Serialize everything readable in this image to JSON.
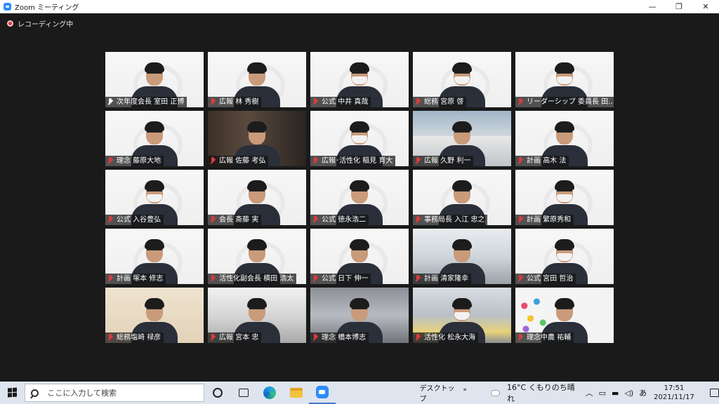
{
  "window": {
    "title": "Zoom ミーティング",
    "controls": [
      "minimize",
      "maximize",
      "close"
    ]
  },
  "recording": {
    "label": "レコーディング中"
  },
  "participants": [
    {
      "label": "次年度会長 室田 正博",
      "active": true,
      "mic": "on",
      "mask": false,
      "bg": "banner"
    },
    {
      "label": "広報 林 秀樹",
      "active": false,
      "mic": "muted",
      "mask": false,
      "bg": "banner"
    },
    {
      "label": "公式 中井 真哉",
      "active": false,
      "mic": "muted",
      "mask": true,
      "bg": "banner"
    },
    {
      "label": "総務 宮原 啓",
      "active": false,
      "mic": "muted",
      "mask": true,
      "bg": "banner"
    },
    {
      "label": "リーダーシップ 委員長 田…",
      "active": false,
      "mic": "muted",
      "mask": true,
      "bg": "banner"
    },
    {
      "label": "理念 藤原大地",
      "active": false,
      "mic": "muted",
      "mask": false,
      "bg": "banner"
    },
    {
      "label": "広報 佐藤 考弘",
      "active": false,
      "mic": "muted",
      "mask": false,
      "bg": "room"
    },
    {
      "label": "広報･活性化 稲見 育大",
      "active": false,
      "mic": "muted",
      "mask": true,
      "bg": "banner"
    },
    {
      "label": "広報 久野 利一",
      "active": false,
      "mic": "muted",
      "mask": false,
      "bg": "building"
    },
    {
      "label": "計画 高木 法",
      "active": false,
      "mic": "muted",
      "mask": false,
      "bg": "banner"
    },
    {
      "label": "公式 入谷豊弘",
      "active": false,
      "mic": "muted",
      "mask": true,
      "bg": "banner"
    },
    {
      "label": "会長 斎藤 実",
      "active": false,
      "mic": "muted",
      "mask": false,
      "bg": "banner"
    },
    {
      "label": "公式 徳永浩二",
      "active": false,
      "mic": "muted",
      "mask": false,
      "bg": "banner"
    },
    {
      "label": "事務局長 入江 忠之",
      "active": false,
      "mic": "muted",
      "mask": false,
      "bg": "banner"
    },
    {
      "label": "計画 繁原秀和",
      "active": false,
      "mic": "muted",
      "mask": true,
      "bg": "banner"
    },
    {
      "label": "計画 塚本 修志",
      "active": false,
      "mic": "muted",
      "mask": false,
      "bg": "banner"
    },
    {
      "label": "活性化副会長 横田 浩太",
      "active": false,
      "mic": "muted",
      "mask": false,
      "bg": "banner"
    },
    {
      "label": "公式 日下 伸一",
      "active": false,
      "mic": "muted",
      "mask": false,
      "bg": "banner"
    },
    {
      "label": "計画 清家隆幸",
      "active": false,
      "mic": "muted",
      "mask": false,
      "bg": "office"
    },
    {
      "label": "公式 宮田 哲治",
      "active": false,
      "mic": "muted",
      "mask": true,
      "bg": "banner"
    },
    {
      "label": "総務塩崎 禄彦",
      "active": false,
      "mic": "muted",
      "mask": false,
      "bg": "wall"
    },
    {
      "label": "広報 宮本 忠",
      "active": false,
      "mic": "muted",
      "mask": false,
      "bg": "hall"
    },
    {
      "label": "理念 橋本博志",
      "active": false,
      "mic": "muted",
      "mask": false,
      "bg": "blur"
    },
    {
      "label": "活性化 松永大海",
      "active": false,
      "mic": "muted",
      "mask": true,
      "bg": "office2"
    },
    {
      "label": "理念中農 祐輔",
      "active": false,
      "mic": "muted",
      "mask": false,
      "bg": "colorful"
    }
  ],
  "taskbar": {
    "search_placeholder": "ここに入力して検索",
    "apps": [
      "cortana",
      "task-view",
      "edge",
      "file-explorer",
      "zoom"
    ],
    "desktop_label": "デスクトップ",
    "weather": "16°C くもりのち晴れ",
    "ime": "あ",
    "time": "17:51",
    "date": "2021/11/17",
    "notification_count": "1"
  }
}
